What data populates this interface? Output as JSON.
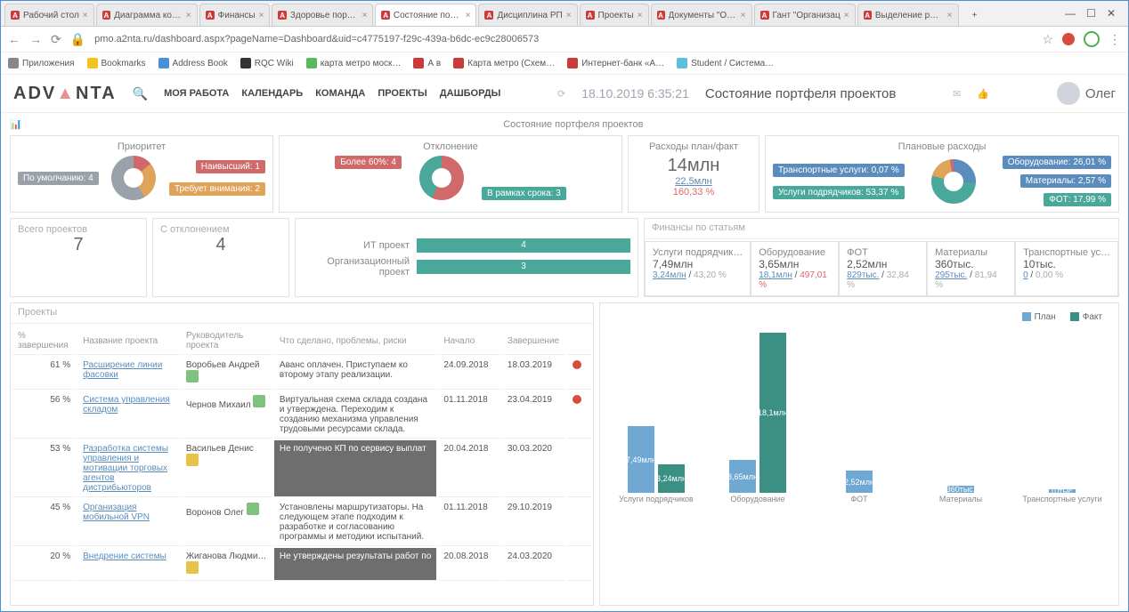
{
  "browser": {
    "tabs": [
      {
        "label": "Рабочий стол"
      },
      {
        "label": "Диаграмма контр"
      },
      {
        "label": "Финансы"
      },
      {
        "label": "Здоровье портфе"
      },
      {
        "label": "Состояние портф",
        "active": true
      },
      {
        "label": "Дисциплина РП"
      },
      {
        "label": "Проекты"
      },
      {
        "label": "Документы \"Орган"
      },
      {
        "label": "Гант \"Организац"
      },
      {
        "label": "Выделение ресур"
      }
    ],
    "url": "pmo.a2nta.ru/dashboard.aspx?pageName=Dashboard&uid=c4775197-f29c-439a-b6dc-ec9c28006573",
    "apps_label": "Приложения",
    "bookmarks": [
      {
        "label": "Bookmarks",
        "icon": "#f0c419"
      },
      {
        "label": "Address Book",
        "icon": "#4a90d9"
      },
      {
        "label": "RQC Wiki",
        "icon": "#333"
      },
      {
        "label": "карта метро моск…",
        "icon": "#5cb85c"
      },
      {
        "label": "А   в",
        "icon": "#cc3a3a"
      },
      {
        "label": "Карта метро (Схем…",
        "icon": "#cc3a3a"
      },
      {
        "label": "Интернет-банк «А…",
        "icon": "#cc3a3a"
      },
      {
        "label": "Student / Система…",
        "icon": "#5bc0de"
      }
    ]
  },
  "header": {
    "logo": "ADVANTA",
    "nav": [
      "МОЯ РАБОТА",
      "КАЛЕНДАРЬ",
      "КОМАНДА",
      "ПРОЕКТЫ",
      "ДАШБОРДЫ"
    ],
    "datetime": "18.10.2019 6:35:21",
    "page_title": "Состояние портфеля проектов",
    "user": "Олег"
  },
  "subtitle": "Состояние портфеля проектов",
  "priority": {
    "title": "Приоритет",
    "tags": [
      {
        "label": "По умолчанию: 4",
        "color": "#9aa1a9"
      },
      {
        "label": "Наивысший: 1",
        "color": "#d06a6a"
      },
      {
        "label": "Требует внимания: 2",
        "color": "#e0a35a"
      }
    ]
  },
  "deviation": {
    "title": "Отклонение",
    "tags": [
      {
        "label": "Более 60%: 4",
        "color": "#d06a6a"
      },
      {
        "label": "В рамках срока: 3",
        "color": "#4aa89a"
      }
    ]
  },
  "expenses_plan_fact": {
    "title": "Расходы план/факт",
    "big": "14млн",
    "plan": "22,5млн",
    "percent": "160,33 %"
  },
  "planned_expenses": {
    "title": "Плановые расходы",
    "tags_left": [
      {
        "label": "Транспортные услуги: 0,07 %",
        "color": "#5a8dbe"
      },
      {
        "label": "Услуги подрядчиков: 53,37 %",
        "color": "#4aa89a"
      }
    ],
    "tags_right": [
      {
        "label": "Оборудование: 26,01 %",
        "color": "#5a8dbe"
      },
      {
        "label": "Материалы: 2,57 %",
        "color": "#5a8dbe"
      },
      {
        "label": "ФОТ: 17,99 %",
        "color": "#4aa89a"
      }
    ]
  },
  "totals": {
    "total_projects_label": "Всего проектов",
    "total_projects": "7",
    "with_deviation_label": "С отклонением",
    "with_deviation": "4"
  },
  "project_types": {
    "rows": [
      {
        "label": "ИТ проект",
        "value": "4"
      },
      {
        "label": "Организационный проект",
        "value": "3"
      }
    ]
  },
  "finance_articles": {
    "title": "Финансы по статьям",
    "items": [
      {
        "name": "Услуги подрядчик…",
        "v1": "7,49млн",
        "v2": "3,24млн",
        "v2b": "43,20 %",
        "color": "#aaa"
      },
      {
        "name": "Оборудование",
        "v1": "3,65млн",
        "v2": "18,1млн",
        "v2b": "497,01 %",
        "color": "#e06666"
      },
      {
        "name": "ФОТ",
        "v1": "2,52млн",
        "v2": "829тыс.",
        "v2b": "32,84 %",
        "color": "#aaa"
      },
      {
        "name": "Материалы",
        "v1": "360тыс.",
        "v2": "295тыс.",
        "v2b": "81,94 %",
        "color": "#aaa"
      },
      {
        "name": "Транспортные ус…",
        "v1": "10тыс.",
        "v2": "0",
        "v2b": "0,00 %",
        "color": "#aaa"
      }
    ]
  },
  "projects_table": {
    "title": "Проекты",
    "headers": [
      "% завершения",
      "Название проекта",
      "Руководитель проекта",
      "Что сделано, проблемы, риски",
      "Начало",
      "Завершение"
    ],
    "rows": [
      {
        "pct": "61 %",
        "name": "Расширение линии фасовки",
        "mgr": "Воробьев Андрей",
        "flag": "#7fc27f",
        "desc": "Аванс оплачен. Приступаем ко второму этапу реализации.",
        "start": "24.09.2018",
        "end": "18.03.2019",
        "dot": "#d94b3a",
        "dark": false
      },
      {
        "pct": "56 %",
        "name": "Система управления складом",
        "mgr": "Чернов Михаил",
        "flag": "#7fc27f",
        "desc": "Виртуальная схема склада создана и утверждена. Переходим к созданию механизма управления трудовыми ресурсами склада.",
        "start": "01.11.2018",
        "end": "23.04.2019",
        "dot": "#d94b3a",
        "dark": false
      },
      {
        "pct": "53 %",
        "name": "Разработка системы управления и мотивации торговых агентов дистрибьюторов",
        "mgr": "Васильев Денис",
        "flag": "#e8c34a",
        "desc": "Не получено КП по сервису выплат",
        "start": "20.04.2018",
        "end": "30.03.2020",
        "dot": null,
        "dark": true
      },
      {
        "pct": "45 %",
        "name": "Организация мобильной VPN",
        "mgr": "Воронов Олег",
        "flag": "#7fc27f",
        "desc": "Установлены маршрутизаторы. На следующем этапе подходим к разработке и согласованию программы и методики испытаний.",
        "start": "01.11.2018",
        "end": "29.10.2019",
        "dot": null,
        "dark": false
      },
      {
        "pct": "20 %",
        "name": "Внедрение системы",
        "mgr": "Жиганова Людми…",
        "flag": "#e8c34a",
        "desc": "Не утверждены результаты работ по",
        "start": "20.08.2018",
        "end": "24.03.2020",
        "dot": null,
        "dark": true
      }
    ]
  },
  "chart_data": {
    "type": "bar",
    "legend": {
      "plan": "План",
      "fact": "Факт"
    },
    "categories": [
      "Услуги подрядчиков",
      "Оборудование",
      "ФОТ",
      "Материалы",
      "Транспортные услуги"
    ],
    "series": [
      {
        "name": "План",
        "values": [
          "7,49млн",
          "3,65млн",
          "2,52млн",
          "360тыс.",
          "10тыс."
        ],
        "heights": [
          75,
          37,
          25,
          8,
          4
        ]
      },
      {
        "name": "Факт",
        "values": [
          "3,24млн",
          "18,1млн",
          "",
          "",
          ""
        ],
        "heights": [
          32,
          180,
          0,
          0,
          0
        ]
      }
    ]
  }
}
